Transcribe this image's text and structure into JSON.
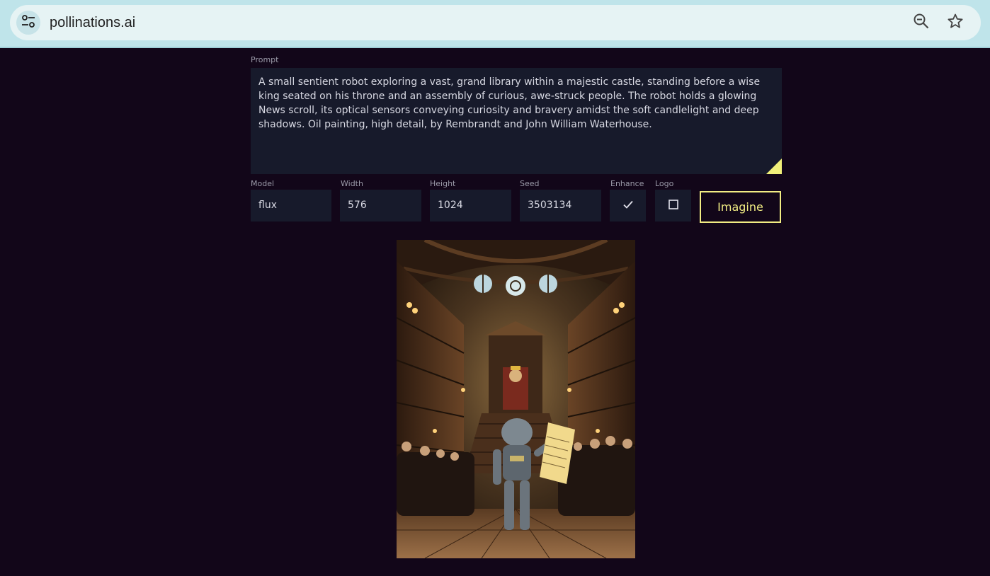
{
  "browser": {
    "url": "pollinations.ai"
  },
  "form": {
    "prompt_label": "Prompt",
    "prompt_value": "A small sentient robot exploring a vast, grand library within a majestic castle, standing before a wise king seated on his throne and an assembly of curious, awe-struck people. The robot holds a glowing News scroll, its optical sensors conveying curiosity and bravery amidst the soft candlelight and deep shadows. Oil painting, high detail, by Rembrandt and John William Waterhouse.",
    "model_label": "Model",
    "model_value": "flux",
    "width_label": "Width",
    "width_value": "576",
    "height_label": "Height",
    "height_value": "1024",
    "seed_label": "Seed",
    "seed_value": "3503134",
    "enhance_label": "Enhance",
    "enhance_checked": true,
    "logo_label": "Logo",
    "logo_checked": false,
    "submit_label": "Imagine"
  },
  "colors": {
    "page_bg": "#120619",
    "field_bg": "#171a2b",
    "accent": "#f1ec83",
    "browser_bar": "#bfe4ea"
  },
  "icons": {
    "site_info": "tune-icon",
    "zoom": "zoom-out-icon",
    "bookmark": "star-icon",
    "enhance": "check-icon",
    "logo": "empty-checkbox-icon"
  }
}
